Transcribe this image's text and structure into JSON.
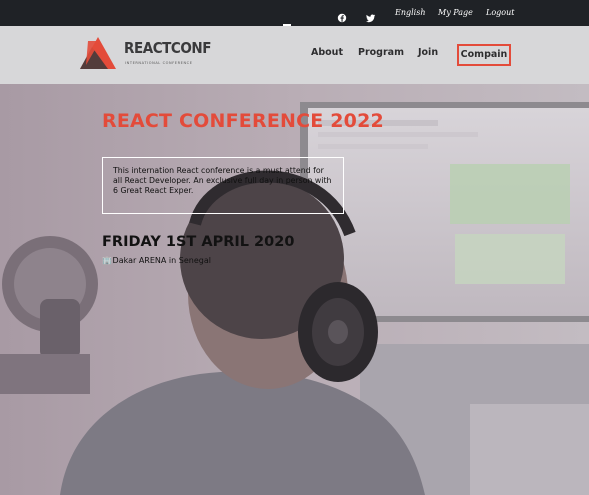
{
  "topbar": {
    "social": [
      {
        "name": "facebook-icon"
      },
      {
        "name": "twitter-icon"
      }
    ],
    "links": [
      "English",
      "My Page",
      "Logout"
    ]
  },
  "header": {
    "brand": "REACTCONF",
    "tagline": "INTERNATIONAL CONFERENCE",
    "nav": [
      "About",
      "Program",
      "Join",
      "Compain"
    ],
    "accent_color": "#e34b3a"
  },
  "hero": {
    "title": "REACT CONFERENCE 2022",
    "description": "This internation React conference is a must attend for all React Developer. An exclusive full day in person with 6 Great React Exper.",
    "date": "FRIDAY 1ST APRIL 2020",
    "venue_icon": "building-icon",
    "venue": "Dakar ARENA in Senegal"
  }
}
